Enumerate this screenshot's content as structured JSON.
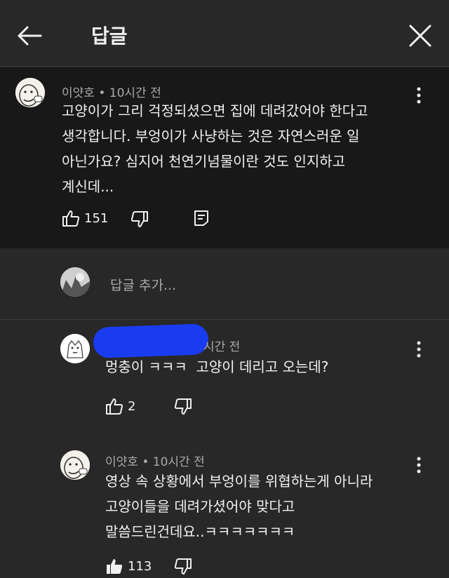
{
  "header": {
    "title": "답글"
  },
  "parent_comment": {
    "author": "이얏호",
    "time": "10시간 전",
    "text": "고양이가 그리 걱정되셨으면 집에 데려갔어야 한다고\n생각합니다. 부엉이가 사냥하는 것은 자연스러운 일\n아닌가요? 심지어 천연기념물이란 것도 인지하고\n계신데...",
    "likes": "151"
  },
  "add_reply": {
    "placeholder": "답글 추가..."
  },
  "replies": [
    {
      "author": "",
      "time": "시간 전",
      "text": "멍충이 ㅋㅋㅋ  고양이 데리고 오는데?",
      "likes": "2"
    },
    {
      "author": "이얏호",
      "time": "10시간 전",
      "text": "영상 속 상황에서 부엉이를 위협하는게 아니라\n고양이들을 데려가셨어야 맞다고\n말씀드린건데요..ㅋㅋㅋㅋㅋㅋㅋ",
      "likes": "113"
    }
  ],
  "separator": "•",
  "colors": {
    "background": "#282828",
    "highlight": "#181818",
    "text": "#f1f1f1",
    "meta": "#aaaaaa",
    "redaction": "#1a3cf0"
  },
  "icons": [
    "back-arrow-icon",
    "close-icon",
    "kebab-menu-icon",
    "thumbs-up-icon",
    "thumbs-down-icon",
    "reply-icon"
  ]
}
